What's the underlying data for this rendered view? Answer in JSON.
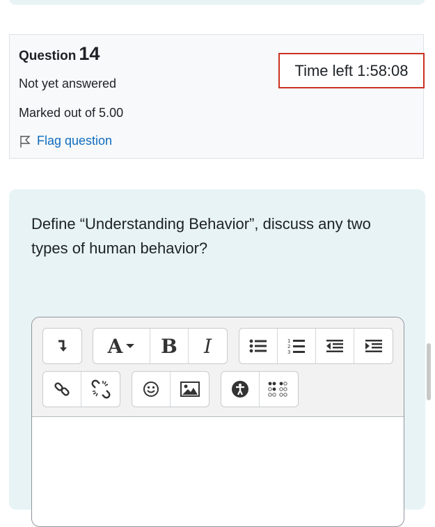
{
  "question": {
    "label": "Question",
    "number": "14",
    "status": "Not yet answered",
    "marks": "Marked out of 5.00",
    "flag_label": "Flag question",
    "timer": "Time left 1:58:08",
    "text": "Define “Understanding Behavior”, discuss any two types of human behavior?"
  },
  "toolbar": {
    "row1": [
      "collapse-icon",
      "font-color-icon",
      "bold-icon",
      "italic-icon",
      "unordered-list-icon",
      "ordered-list-icon",
      "outdent-icon",
      "indent-icon"
    ],
    "row2": [
      "link-icon",
      "unlink-icon",
      "emoji-icon",
      "image-icon",
      "accessibility-icon",
      "braille-icon"
    ],
    "bold_glyph": "B",
    "italic_glyph": "I",
    "font_glyph": "A"
  },
  "colors": {
    "accent": "#0f6cbf",
    "timer_border": "#ca3120",
    "panel_bg": "#e7f3f5"
  }
}
